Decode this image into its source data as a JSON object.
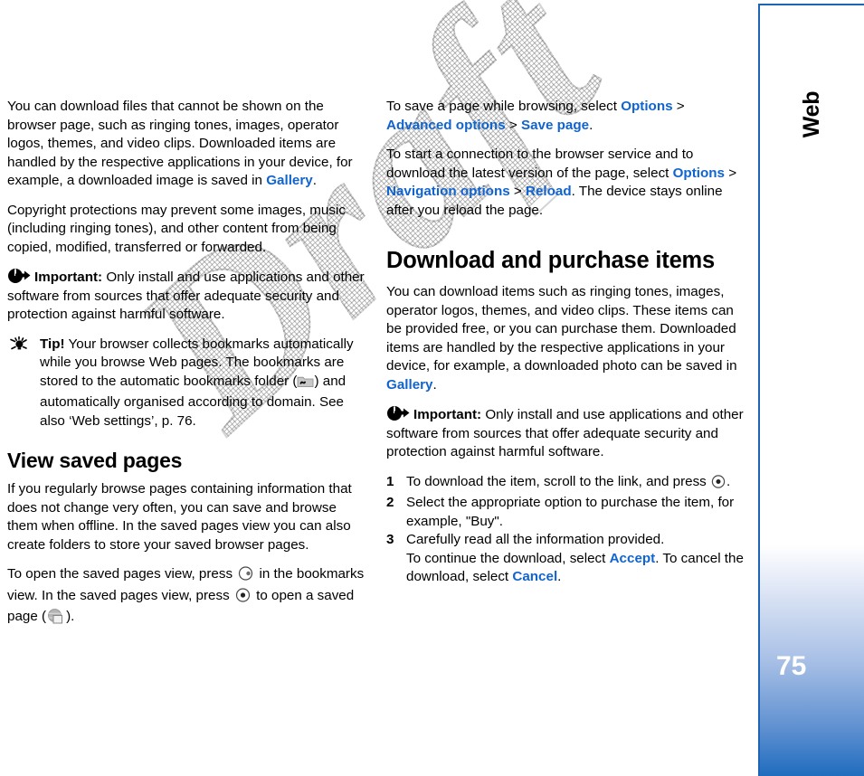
{
  "document": {
    "chapter_tab": "Web",
    "page_number": "75",
    "watermark": "Draft",
    "link_color": "#1164ce",
    "accent_color": "#1c64b4"
  },
  "left_column": {
    "p1": {
      "a": "You can download files that cannot be shown on the browser page, such as ringing tones, images, operator logos, themes, and video clips. Downloaded items are handled by the respective applications in your device, for example, a downloaded image is saved in ",
      "link": "Gallery",
      "b": "."
    },
    "p2": "Copyright protections may prevent some images, music (including ringing tones), and other content from being copied, modified, transferred or forwarded.",
    "important": {
      "icon": "important-arrow-icon",
      "label": "Important:",
      "text": " Only install and use applications and other software from sources that offer adequate security and protection against harmful software."
    },
    "tip": {
      "icon": "lightbulb-tip-icon",
      "label": "Tip!",
      "text_a": " Your browser collects bookmarks automatically while you browse Web pages. The bookmarks are stored to the automatic bookmarks folder (",
      "folder_icon": "automatic-bookmarks-folder-icon",
      "text_b": ") and automatically organised according to domain. See also ‘Web settings’, p. 76."
    },
    "heading": "View saved pages",
    "p3": "If you regularly browse pages containing information that does not change very often, you can save and browse them when offline. In the saved pages view you can also create folders to store your saved browser pages.",
    "p4": {
      "a": "To open the saved pages view, press ",
      "icon1": "scroll-right-key-icon",
      "b": " in the bookmarks view. In the saved pages view, press ",
      "icon2": "select-key-icon",
      "c": " to open a saved page (",
      "icon3": "saved-page-globe-icon",
      "d": ")."
    }
  },
  "right_column": {
    "p1": {
      "a": "To save a page while browsing, select ",
      "link1": "Options",
      "sep1": " > ",
      "link2": "Advanced options",
      "sep2": " > ",
      "link3": "Save page",
      "b": "."
    },
    "p2": {
      "a": "To start a connection to the browser service and to download the latest version of the page, select ",
      "link1": "Options",
      "sep1": " > ",
      "link2": "Navigation options",
      "sep2": " > ",
      "link3": "Reload",
      "b": ". The device stays online after you reload the page."
    },
    "heading": "Download and purchase items",
    "p3": {
      "a": "You can download items such as ringing tones, images, operator logos, themes, and video clips. These items can be provided free, or you can purchase them. Downloaded items are handled by the respective applications in your device, for example, a downloaded photo can be saved in ",
      "link": "Gallery",
      "b": "."
    },
    "important": {
      "icon": "important-arrow-icon",
      "label": "Important:",
      "text": " Only install and use applications and other software from sources that offer adequate security and protection against harmful software."
    },
    "steps": [
      {
        "num": "1",
        "text_a": "To download the item, scroll to the link, and press ",
        "icon": "select-key-icon",
        "text_b": "."
      },
      {
        "num": "2",
        "text_a": "Select the appropriate option to purchase the item, for example, \"Buy\".",
        "text_b": ""
      },
      {
        "num": "3",
        "text_a": "Carefully read all the information provided.",
        "line2_a": "To continue the download, select ",
        "link1": "Accept",
        "line2_b": ". To cancel the download, select ",
        "link2": "Cancel",
        "line2_c": "."
      }
    ]
  }
}
